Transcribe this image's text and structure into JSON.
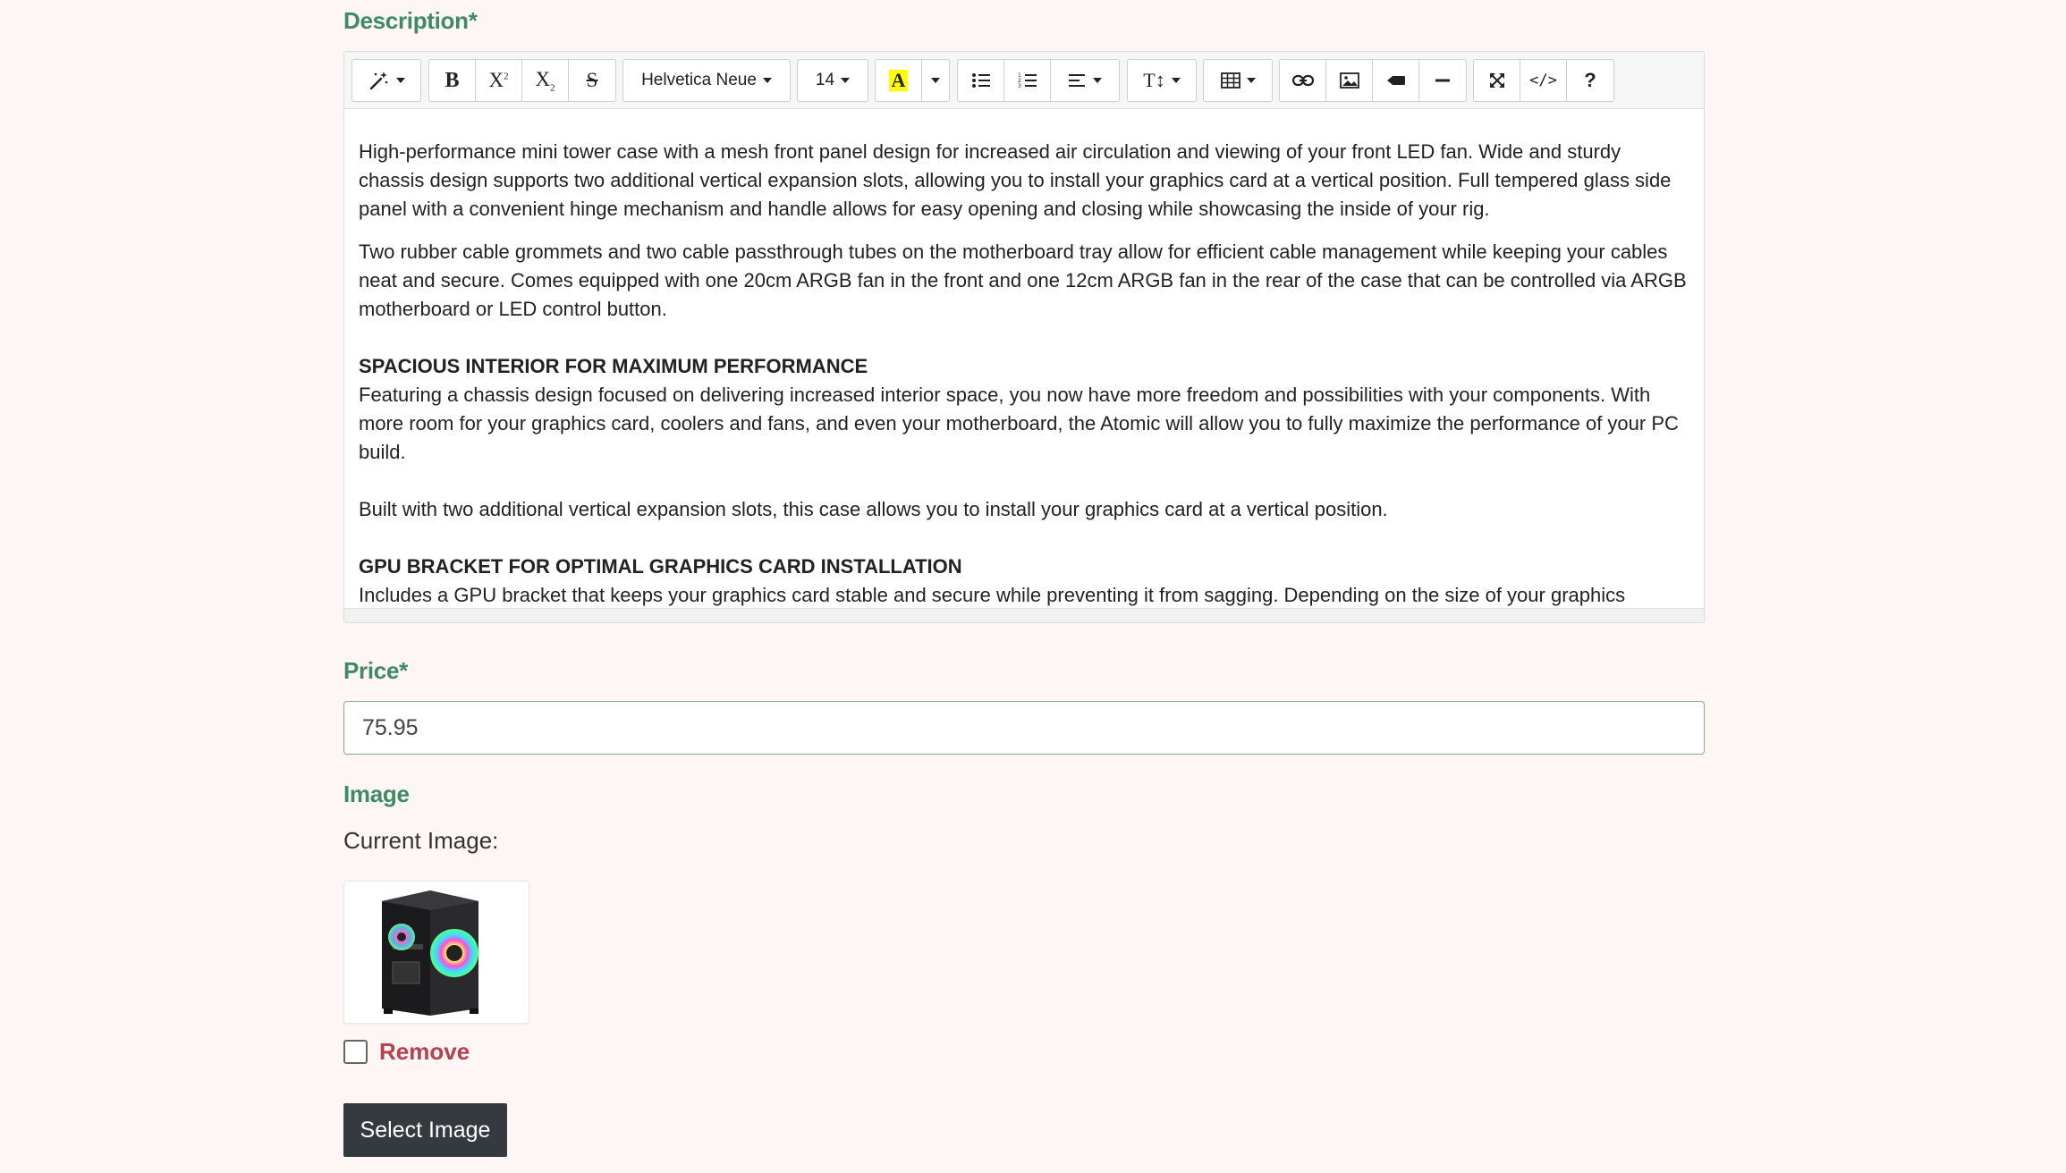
{
  "description": {
    "label": "Description*",
    "toolbar": {
      "font_family": "Helvetica Neue",
      "font_size": "14",
      "help_label": "?"
    },
    "content": {
      "p1": "High-performance mini tower case with a mesh front panel design for increased air circulation and viewing of your front LED fan. Wide and sturdy chassis design supports two additional vertical expansion slots, allowing you to install your graphics card at a vertical position. Full tempered glass side panel with a convenient hinge mechanism and handle allows for easy opening and closing while showcasing the inside of your rig.",
      "p2": "Two rubber cable grommets and two cable passthrough tubes on the motherboard tray allow for efficient cable management while keeping your cables neat and secure. Comes equipped with one 20cm ARGB fan in the front and one 12cm ARGB fan in the rear of the case that can be controlled via ARGB motherboard or LED control button.",
      "h1": "SPACIOUS INTERIOR FOR MAXIMUM PERFORMANCE",
      "p3": "Featuring a chassis design focused on delivering increased interior space, you now have more freedom and possibilities with your components. With more room for your graphics card, coolers and fans, and even your motherboard, the Atomic will allow you to fully maximize the performance of your PC build.",
      "p4": "Built with two additional vertical expansion slots, this case allows you to install your graphics card at a vertical position.",
      "h2": "GPU BRACKET FOR OPTIMAL GRAPHICS CARD INSTALLATION",
      "p5": "Includes a GPU bracket that keeps your graphics card stable and secure while preventing it from sagging. Depending on the size of your graphics"
    }
  },
  "price": {
    "label": "Price*",
    "value": "75.95"
  },
  "image": {
    "label": "Image",
    "current_label": "Current Image:",
    "remove_label": "Remove",
    "select_button": "Select Image"
  },
  "colors": {
    "label_green": "#3d8a64",
    "remove_red": "#b5414d",
    "button_dark": "#343a40",
    "page_bg": "#fdf6f5"
  }
}
